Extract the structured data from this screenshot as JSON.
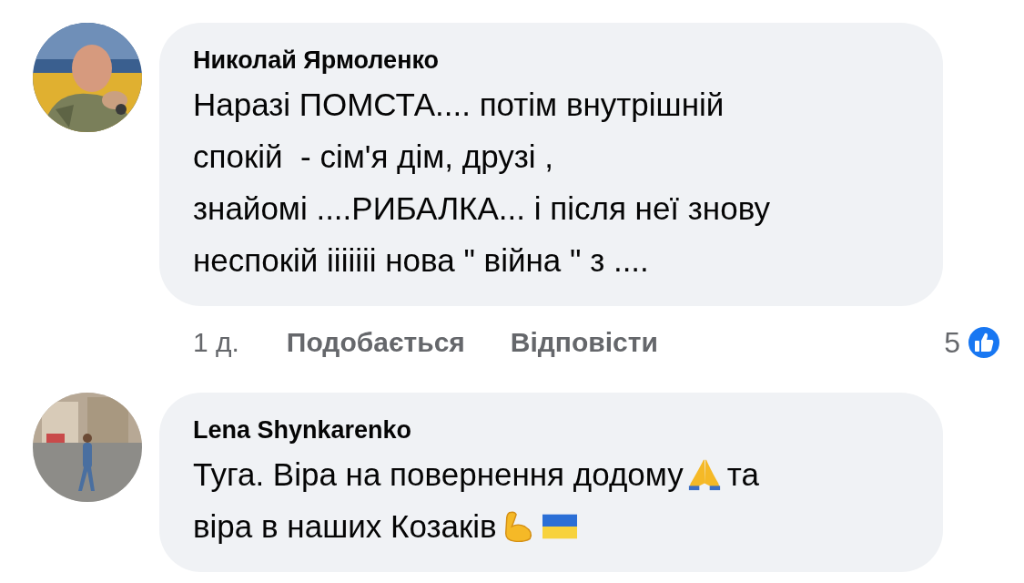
{
  "comments": [
    {
      "author": "Николай Ярмоленко",
      "avatar": {
        "kind": "picture"
      },
      "lines": [
        [
          {
            "kind": "text",
            "text": "Наразі ПОМСТА.... потім внутрішній"
          }
        ],
        [
          {
            "kind": "text",
            "text": "спокій  - сім'я дім, друзі ,"
          }
        ],
        [
          {
            "kind": "text",
            "text": "знайомі ....РИБАЛКА... і після неї знову"
          }
        ],
        [
          {
            "kind": "text",
            "text": "неспокій ііііііі нова \" війна \" з ...."
          }
        ]
      ],
      "actions": {
        "time": "1 д.",
        "like": "Подобається",
        "reply": "Відповісти",
        "reactions": "5"
      }
    },
    {
      "author": "Lena Shynkarenko",
      "avatar": {
        "kind": "picture"
      },
      "lines": [
        [
          {
            "kind": "text",
            "text": "Туга. Віра на повернення додому"
          },
          {
            "kind": "pray"
          },
          {
            "kind": "text",
            "text": "та"
          }
        ],
        [
          {
            "kind": "text",
            "text": "віра в наших Козаків"
          },
          {
            "kind": "muscle"
          },
          {
            "kind": "flag"
          }
        ]
      ]
    }
  ]
}
